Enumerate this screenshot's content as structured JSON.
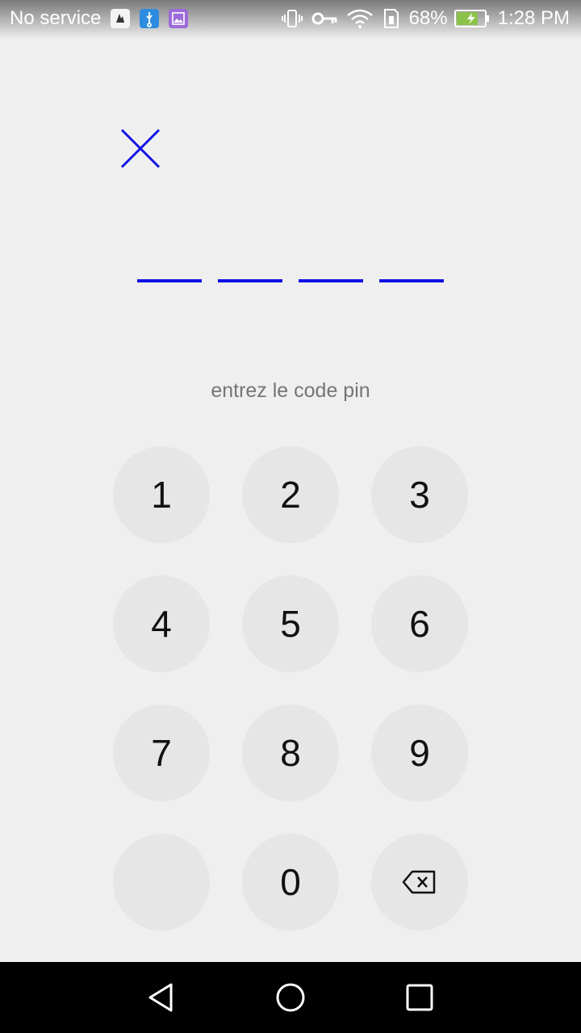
{
  "status_bar": {
    "carrier": "No service",
    "notifications": [
      "app-notification-icon",
      "usb-icon",
      "gallery-icon"
    ],
    "battery_percent": "68%",
    "time": "1:28 PM",
    "icons": [
      "vibrate-icon",
      "vpn-key-icon",
      "wifi-icon",
      "data-saver-icon",
      "battery-charging-icon"
    ]
  },
  "pin": {
    "slot_count": 4,
    "prompt": "entrez le code pin"
  },
  "keypad": {
    "rows": [
      [
        "1",
        "2",
        "3"
      ],
      [
        "4",
        "5",
        "6"
      ],
      [
        "7",
        "8",
        "9"
      ],
      [
        "",
        "0",
        "backspace"
      ]
    ]
  },
  "colors": {
    "accent": "#1010e6",
    "background": "#efefef",
    "key_background": "#e6e6e6",
    "prompt_text": "#757575"
  }
}
